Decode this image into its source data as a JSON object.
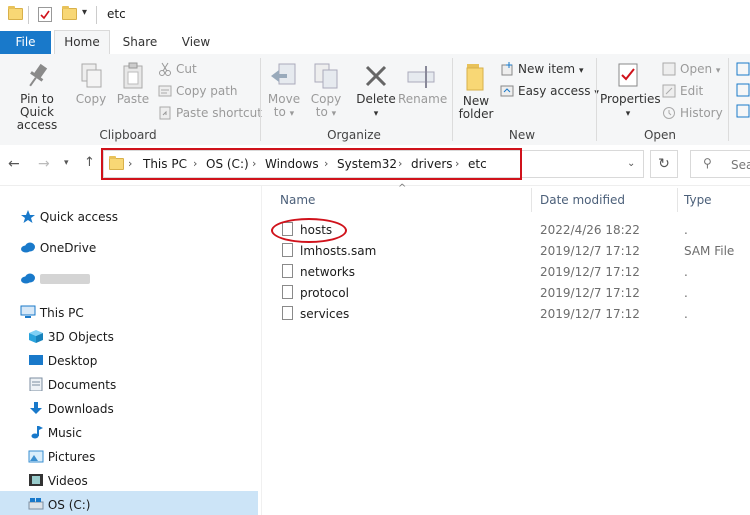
{
  "window": {
    "title": "etc"
  },
  "tabs": [
    {
      "label": "File"
    },
    {
      "label": "Home"
    },
    {
      "label": "Share"
    },
    {
      "label": "View"
    }
  ],
  "ribbon": {
    "clipboard": {
      "group_label": "Clipboard",
      "pin_label": [
        "Pin to Quick",
        "access"
      ],
      "copy_label": "Copy",
      "paste_label": "Paste",
      "cut_label": "Cut",
      "copy_path_label": "Copy path",
      "paste_shortcut_label": "Paste shortcut"
    },
    "organize": {
      "group_label": "Organize",
      "move_to_label": [
        "Move",
        "to"
      ],
      "copy_to_label": [
        "Copy",
        "to"
      ],
      "delete_label": "Delete",
      "rename_label": "Rename"
    },
    "new": {
      "group_label": "New",
      "new_folder_label": [
        "New",
        "folder"
      ],
      "new_item_label": "New item",
      "easy_access_label": "Easy access"
    },
    "open": {
      "group_label": "Open",
      "properties_label": "Properties",
      "open_label": "Open",
      "edit_label": "Edit",
      "history_label": "History"
    }
  },
  "address": {
    "crumbs": [
      "This PC",
      "OS (C:)",
      "Windows",
      "System32",
      "drivers",
      "etc"
    ],
    "search_placeholder": "Sea"
  },
  "nav": {
    "items": [
      {
        "label": "Quick access",
        "icon": "star-icon"
      },
      {
        "label": "OneDrive",
        "icon": "cloud-icon"
      },
      {
        "label": "",
        "icon": "cloud-icon"
      },
      {
        "label": "This PC",
        "icon": "computer-icon"
      },
      {
        "label": "3D Objects",
        "icon": "cube-icon"
      },
      {
        "label": "Desktop",
        "icon": "desktop-icon"
      },
      {
        "label": "Documents",
        "icon": "document-icon"
      },
      {
        "label": "Downloads",
        "icon": "download-icon"
      },
      {
        "label": "Music",
        "icon": "music-icon"
      },
      {
        "label": "Pictures",
        "icon": "picture-icon"
      },
      {
        "label": "Videos",
        "icon": "video-icon"
      },
      {
        "label": "OS (C:)",
        "icon": "drive-icon"
      }
    ]
  },
  "files": {
    "columns": {
      "name": "Name",
      "date": "Date modified",
      "type": "Type"
    },
    "rows": [
      {
        "name": "hosts",
        "date": "2022/4/26 18:22",
        "type": "."
      },
      {
        "name": "lmhosts.sam",
        "date": "2019/12/7 17:12",
        "type": "SAM File"
      },
      {
        "name": "networks",
        "date": "2019/12/7 17:12",
        "type": "."
      },
      {
        "name": "protocol",
        "date": "2019/12/7 17:12",
        "type": "."
      },
      {
        "name": "services",
        "date": "2019/12/7 17:12",
        "type": "."
      }
    ]
  },
  "colors": {
    "accent": "#1979ca",
    "highlight": "#d0121b",
    "folder": "#f8d775",
    "selected": "#cce4f7"
  }
}
